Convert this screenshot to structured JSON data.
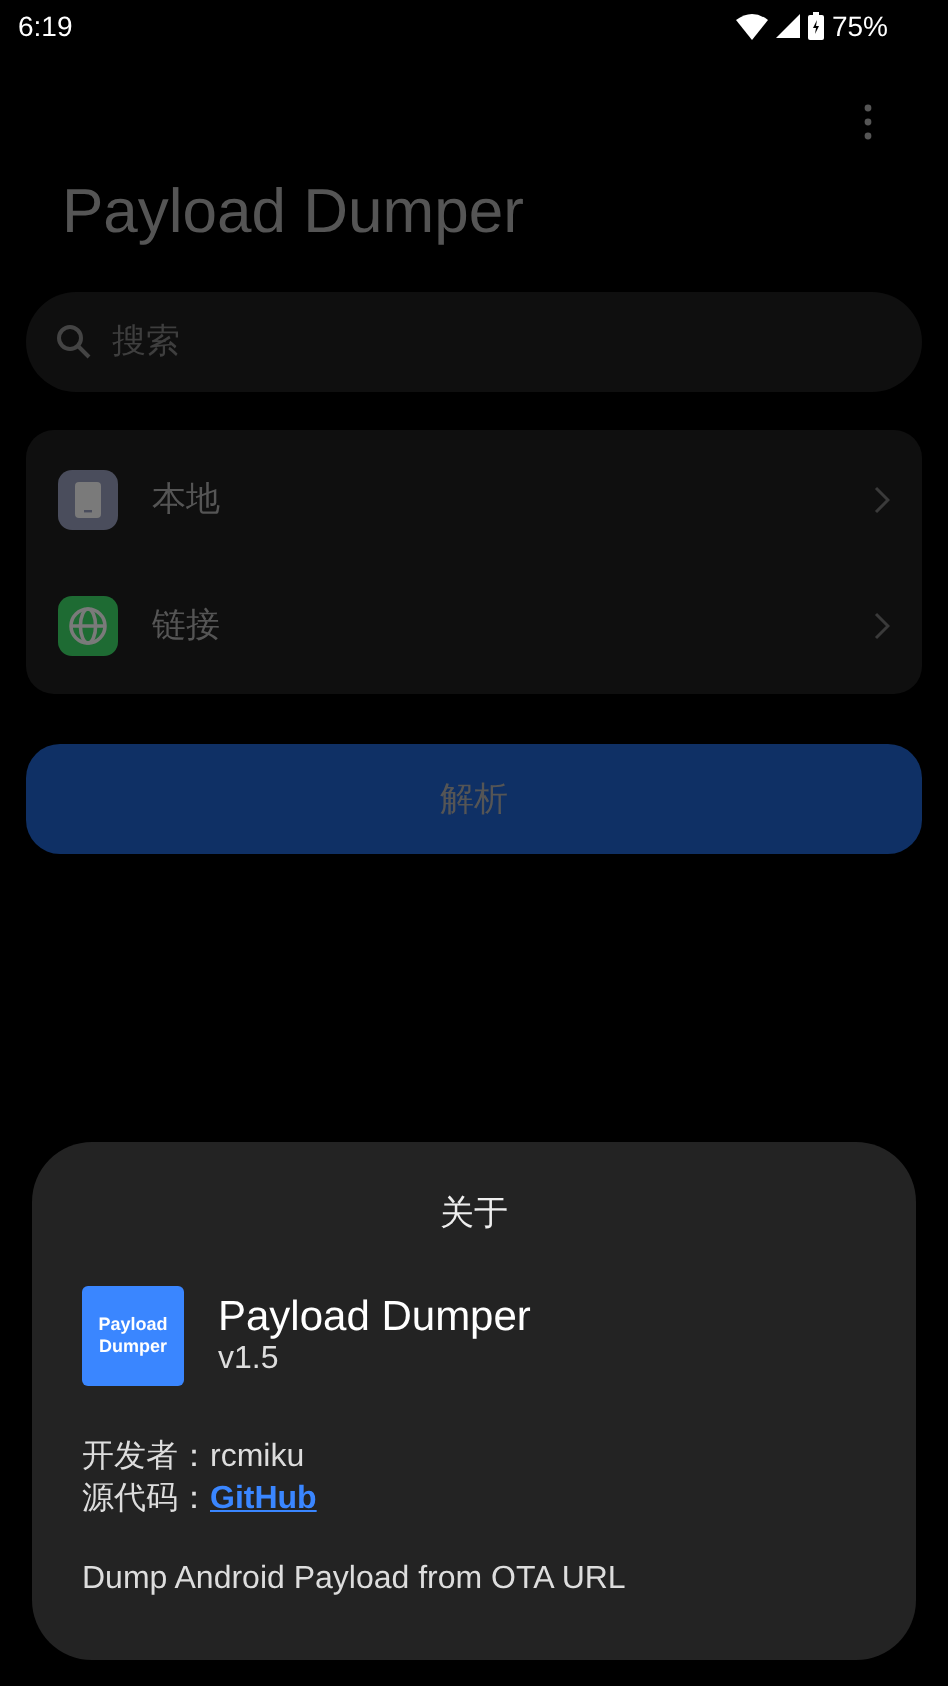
{
  "status_bar": {
    "time": "6:19",
    "battery": "75%"
  },
  "title": "Payload Dumper",
  "search": {
    "placeholder": "搜索"
  },
  "sources": [
    {
      "kind": "device",
      "label": "本地"
    },
    {
      "kind": "web",
      "label": "链接"
    }
  ],
  "parse_button": "解析",
  "dialog": {
    "title": "关于",
    "logo_lines": [
      "Payload",
      "Dumper"
    ],
    "app_name": "Payload Dumper",
    "version": "v1.5",
    "developer": "开发者：rcmiku",
    "source_label": "源代码：",
    "source_link": "GitHub",
    "description": "Dump Android Payload from OTA URL"
  }
}
